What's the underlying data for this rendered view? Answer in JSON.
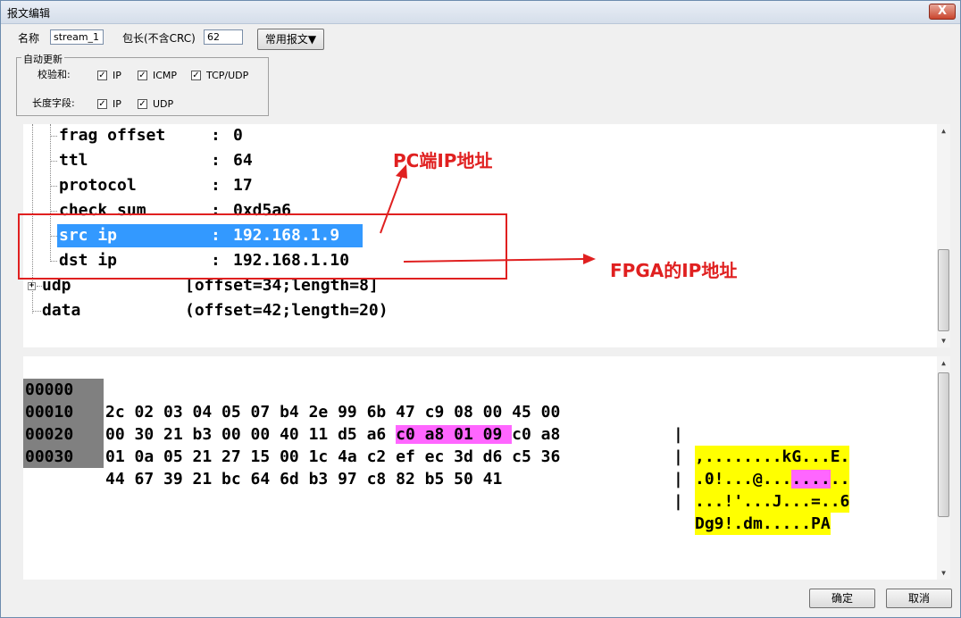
{
  "window": {
    "title": "报文编辑",
    "close_glyph": "X"
  },
  "form": {
    "name_label": "名称",
    "name_value": "stream_1",
    "length_label": "包长(不含CRC)",
    "length_value": "62",
    "common_button": "常用报文▼"
  },
  "auto_update": {
    "title": "自动更新",
    "checksum_label": "校验和:",
    "length_field_label": "长度字段:",
    "checksum_items": [
      "IP",
      "ICMP",
      "TCP/UDP"
    ],
    "length_items": [
      "IP",
      "UDP"
    ],
    "check_glyph": "✓"
  },
  "tree": {
    "rows": [
      {
        "key": "frag offset",
        "value": "0"
      },
      {
        "key": "ttl",
        "value": "64"
      },
      {
        "key": "protocol",
        "value": "17"
      },
      {
        "key": "check sum",
        "value": "0xd5a6"
      },
      {
        "key": "src ip",
        "value": "192.168.1.9"
      },
      {
        "key": "dst ip",
        "value": "192.168.1.10"
      }
    ],
    "sep": ":",
    "udp": {
      "name": "udp",
      "info": "[offset=34;length=8]"
    },
    "data": {
      "name": "data",
      "info": "(offset=42;length=20)"
    },
    "expander_glyph": "+"
  },
  "hex": {
    "rows": [
      {
        "offset": "00000",
        "pre": "2c 02 03 04 05 07 b4 2e 99 6b 47 c9 08 00 45 00",
        "hl": "",
        "post": "",
        "ascii_pre": ",........kG...E.",
        "ascii_hl": "",
        "ascii_post": ""
      },
      {
        "offset": "00010",
        "pre": "00 30 21 b3 00 00 40 11 d5 a6 ",
        "hl": "c0 a8 01 09 ",
        "post": "c0 a8",
        "ascii_pre": ".0!...@...",
        "ascii_hl": "....",
        "ascii_post": ".."
      },
      {
        "offset": "00020",
        "pre": "01 0a 05 21 27 15 00 1c 4a c2 ef ec 3d d6 c5 36",
        "hl": "",
        "post": "",
        "ascii_pre": "...!'...J...=..6",
        "ascii_hl": "",
        "ascii_post": ""
      },
      {
        "offset": "00030",
        "pre": "44 67 39 21 bc 64 6d b3 97 c8 82 b5 50 41",
        "hl": "",
        "post": "",
        "ascii_pre": "Dg9!.dm.....PA",
        "ascii_hl": "",
        "ascii_post": ""
      }
    ],
    "bar": "|"
  },
  "annotations": {
    "pc_ip": "PC端IP地址",
    "fpga_ip": "FPGA的IP地址",
    "color": "#e02020"
  },
  "buttons": {
    "ok": "确定",
    "cancel": "取消"
  },
  "colors": {
    "selection": "#3399ff",
    "highlight": "#ff66ff",
    "ascii_bg": "#ffff00",
    "offset_bg": "#808080"
  }
}
